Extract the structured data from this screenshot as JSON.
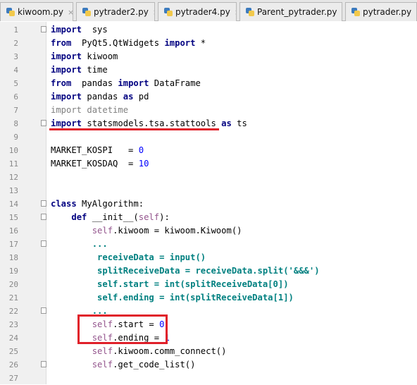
{
  "tabs": [
    {
      "label": "kiwoom.py"
    },
    {
      "label": "pytrader2.py"
    },
    {
      "label": "pytrader4.py"
    },
    {
      "label": "Parent_pytrader.py"
    },
    {
      "label": "pytrader.py"
    }
  ],
  "tab_close_glyph": "×",
  "lines": [
    {
      "n": "1",
      "parts": [
        [
          "kw",
          "import"
        ],
        [
          "",
          "  sys"
        ]
      ]
    },
    {
      "n": "2",
      "parts": [
        [
          "kw",
          "from"
        ],
        [
          "",
          "  PyQt5.QtWidgets "
        ],
        [
          "kw",
          "import"
        ],
        [
          "",
          " *"
        ]
      ]
    },
    {
      "n": "3",
      "parts": [
        [
          "kw",
          "import"
        ],
        [
          "",
          " kiwoom"
        ]
      ]
    },
    {
      "n": "4",
      "parts": [
        [
          "kw",
          "import"
        ],
        [
          "",
          " time"
        ]
      ]
    },
    {
      "n": "5",
      "parts": [
        [
          "kw",
          "from"
        ],
        [
          "",
          "  pandas "
        ],
        [
          "kw",
          "import"
        ],
        [
          "",
          " DataFrame"
        ]
      ]
    },
    {
      "n": "6",
      "parts": [
        [
          "kw",
          "import"
        ],
        [
          "",
          " pandas "
        ],
        [
          "kw",
          "as"
        ],
        [
          "",
          " pd"
        ]
      ]
    },
    {
      "n": "7",
      "parts": [
        [
          "gray",
          "import datetime"
        ]
      ]
    },
    {
      "n": "8",
      "parts": [
        [
          "kw",
          "import"
        ],
        [
          "",
          " statsmodels.tsa.stattools "
        ],
        [
          "kw",
          "as"
        ],
        [
          "",
          " ts"
        ]
      ]
    },
    {
      "n": "9",
      "parts": []
    },
    {
      "n": "10",
      "parts": [
        [
          "",
          "MARKET_KOSPI   = "
        ],
        [
          "num",
          "0"
        ]
      ]
    },
    {
      "n": "11",
      "parts": [
        [
          "",
          "MARKET_KOSDAQ  = "
        ],
        [
          "num",
          "10"
        ]
      ]
    },
    {
      "n": "12",
      "parts": []
    },
    {
      "n": "13",
      "parts": []
    },
    {
      "n": "14",
      "parts": [
        [
          "kw",
          "class"
        ],
        [
          "",
          " MyAlgorithm:"
        ]
      ]
    },
    {
      "n": "15",
      "parts": [
        [
          "",
          "    "
        ],
        [
          "kw",
          "def"
        ],
        [
          "",
          " __init__("
        ],
        [
          "slf",
          "self"
        ],
        [
          "",
          "):"
        ]
      ]
    },
    {
      "n": "16",
      "parts": [
        [
          "",
          "        "
        ],
        [
          "slf",
          "self"
        ],
        [
          "",
          ".kiwoom = kiwoom.Kiwoom()"
        ]
      ]
    },
    {
      "n": "17",
      "parts": [
        [
          "",
          "        "
        ],
        [
          "green",
          "..."
        ]
      ]
    },
    {
      "n": "18",
      "parts": [
        [
          "",
          "         "
        ],
        [
          "green",
          "receiveData = input()"
        ]
      ]
    },
    {
      "n": "19",
      "parts": [
        [
          "",
          "         "
        ],
        [
          "green",
          "splitReceiveData = receiveData.split('&&&')"
        ]
      ]
    },
    {
      "n": "20",
      "parts": [
        [
          "",
          "         "
        ],
        [
          "green",
          "self.start = int(splitReceiveData[0])"
        ]
      ]
    },
    {
      "n": "21",
      "parts": [
        [
          "",
          "         "
        ],
        [
          "green",
          "self.ending = int(splitReceiveData[1])"
        ]
      ]
    },
    {
      "n": "22",
      "parts": [
        [
          "",
          "        "
        ],
        [
          "green",
          "..."
        ]
      ]
    },
    {
      "n": "23",
      "parts": [
        [
          "",
          "        "
        ],
        [
          "slf",
          "self"
        ],
        [
          "",
          ".start = "
        ],
        [
          "num",
          "0"
        ]
      ]
    },
    {
      "n": "24",
      "parts": [
        [
          "",
          "        "
        ],
        [
          "slf",
          "self"
        ],
        [
          "",
          ".ending = "
        ],
        [
          "num",
          "1"
        ]
      ]
    },
    {
      "n": "25",
      "parts": [
        [
          "",
          "        "
        ],
        [
          "slf",
          "self"
        ],
        [
          "",
          ".kiwoom.comm_connect()"
        ]
      ]
    },
    {
      "n": "26",
      "parts": [
        [
          "",
          "        "
        ],
        [
          "slf",
          "self"
        ],
        [
          "",
          ".get_code_list()"
        ]
      ]
    },
    {
      "n": "27",
      "parts": []
    }
  ],
  "fold_markers": [
    "1",
    "8",
    "14",
    "15",
    "17",
    "22",
    "26"
  ],
  "annotation_colors": {
    "highlight": "#e0202a"
  }
}
